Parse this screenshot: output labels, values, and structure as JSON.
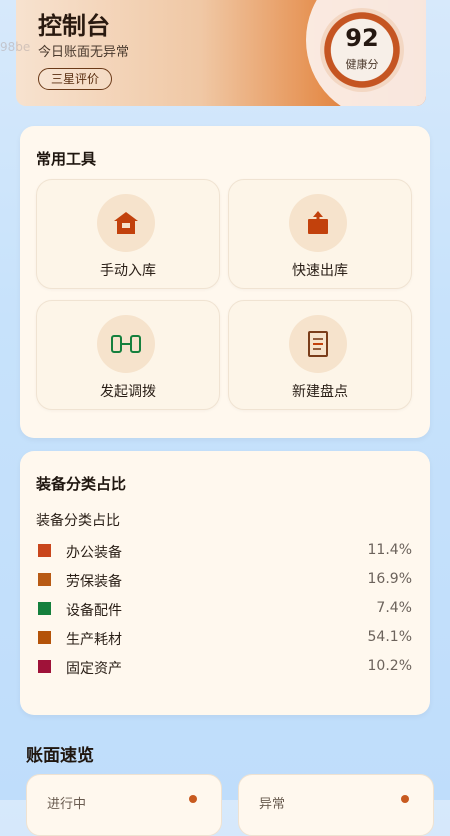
{
  "colors": {
    "accent": "#c85a1f",
    "card_bg": "#fff8ee",
    "text_dark": "#1f160f"
  },
  "header": {
    "ghost_text": "98be",
    "title": "控制台",
    "subtitle": "今日账面无异常",
    "rating_label": "三星评价",
    "health": {
      "score": "92",
      "label": "健康分"
    }
  },
  "tools_card": {
    "title": "常用工具",
    "items": [
      {
        "label": "手动入库",
        "icon": "warehouse-in-icon"
      },
      {
        "label": "快速出库",
        "icon": "box-out-icon"
      },
      {
        "label": "发起调拨",
        "icon": "transfer-icon"
      },
      {
        "label": "新建盘点",
        "icon": "inventory-sheet-icon"
      }
    ]
  },
  "distribution_card": {
    "title": "装备分类占比",
    "subtitle": "装备分类占比",
    "chart_data": {
      "type": "pie",
      "title": "装备分类占比",
      "categories": [
        "办公装备",
        "劳保装备",
        "设备配件",
        "生产耗材",
        "固定资产"
      ],
      "values": [
        11.4,
        16.9,
        7.4,
        54.1,
        10.2
      ],
      "value_labels": [
        "11.4%",
        "16.9%",
        "7.4%",
        "54.1%",
        "10.2%"
      ],
      "colors": [
        "#c9461c",
        "#b85a14",
        "#15803d",
        "#b45309",
        "#9f1239"
      ],
      "legend": "left"
    }
  },
  "overview": {
    "title": "账面速览",
    "cards": [
      {
        "label": "进行中"
      },
      {
        "label": "异常"
      }
    ]
  }
}
